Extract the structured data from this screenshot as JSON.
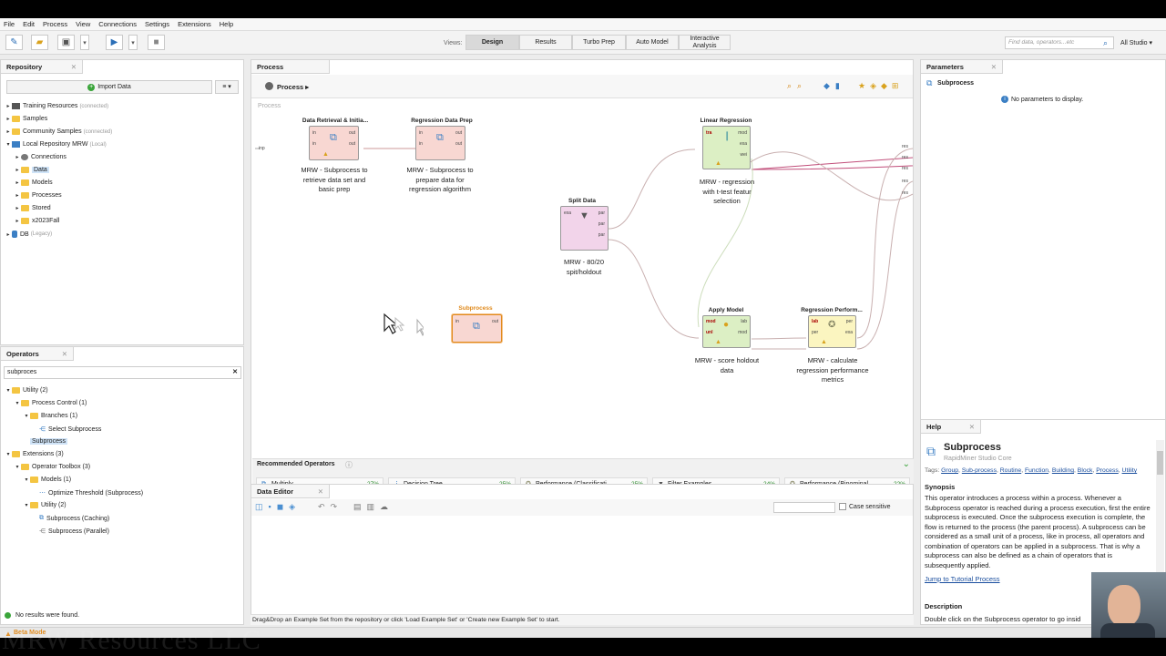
{
  "menu": [
    "File",
    "Edit",
    "Process",
    "View",
    "Connections",
    "Settings",
    "Extensions",
    "Help"
  ],
  "views": {
    "label": "Views:",
    "tabs": [
      "Design",
      "Results",
      "Turbo Prep",
      "Auto Model",
      "Interactive Analysis"
    ],
    "active": "Design"
  },
  "search": {
    "placeholder": "Find data, operators...etc",
    "studio": "All Studio"
  },
  "repository": {
    "title": "Repository",
    "import_label": "Import Data",
    "items": [
      {
        "label": "Training Resources",
        "note": "(connected)"
      },
      {
        "label": "Samples",
        "note": ""
      },
      {
        "label": "Community Samples",
        "note": "(connected)"
      },
      {
        "label": "Local Repository MRW",
        "note": "(Local)"
      },
      {
        "label": "Connections",
        "note": ""
      },
      {
        "label": "Data",
        "note": ""
      },
      {
        "label": "Models",
        "note": ""
      },
      {
        "label": "Processes",
        "note": ""
      },
      {
        "label": "Stored",
        "note": ""
      },
      {
        "label": "x2023Fall",
        "note": ""
      },
      {
        "label": "DB",
        "note": "(Legacy)"
      }
    ]
  },
  "operators": {
    "title": "Operators",
    "search_value": "subproces",
    "items": [
      "Utility (2)",
      "Process Control (1)",
      "Branches (1)",
      "Select Subprocess",
      "Subprocess",
      "Extensions (3)",
      "Operator Toolbox (3)",
      "Models (1)",
      "Optimize Threshold (Subprocess)",
      "Utility (2)",
      "Subprocess (Caching)",
      "Subprocess (Parallel)"
    ],
    "status": "No results were found."
  },
  "process": {
    "tab": "Process",
    "breadcrumb": "Process",
    "canvas_label": "Process",
    "operators": [
      {
        "title": "Data Retrieval & Initia...",
        "desc": "MRW - Subprocess to retrieve data set and basic prep"
      },
      {
        "title": "Regression Data Prep",
        "desc": "MRW - Subprocess to prepare data for regression algorithm"
      },
      {
        "title": "Split Data",
        "desc": "MRW - 80/20 spit/holdout"
      },
      {
        "title": "Linear Regression",
        "desc": "MRW - regression with t-test featur selection"
      },
      {
        "title": "Apply Model",
        "desc": "MRW - score holdout data"
      },
      {
        "title": "Regression Perform...",
        "desc": "MRW - calculate regression performance metrics"
      },
      {
        "title": "Subprocess",
        "desc": ""
      }
    ]
  },
  "recommended": {
    "title": "Recommended Operators",
    "items": [
      {
        "label": "Multiply",
        "pct": "27%"
      },
      {
        "label": "Decision Tree",
        "pct": "25%"
      },
      {
        "label": "Performance (Classificati...",
        "pct": "25%"
      },
      {
        "label": "Filter Examples",
        "pct": "24%"
      },
      {
        "label": "Performance (Binominal ...",
        "pct": "22%"
      }
    ]
  },
  "data_editor": {
    "title": "Data Editor",
    "case_sensitive": "Case sensitive",
    "hint": "Drag&Drop an Example Set from the repository or click 'Load Example Set' or 'Create new Example Set' to start."
  },
  "parameters": {
    "title": "Parameters",
    "operator": "Subprocess",
    "message": "No parameters to display."
  },
  "help": {
    "title": "Help",
    "op_name": "Subprocess",
    "op_source": "RapidMiner Studio Core",
    "tags_label": "Tags:",
    "tags": [
      "Group",
      "Sub-process",
      "Routine",
      "Function",
      "Building",
      "Block",
      "Process",
      "Utility"
    ],
    "synopsis_title": "Synopsis",
    "synopsis": "This operator introduces a process within a process. Whenever a Subprocess operator is reached during a process execution, first the entire subprocess is executed. Once the subprocess execution is complete, the flow is returned to the process (the parent process). A subprocess can be considered as a small unit of a process, like in process, all operators and combination of operators can be applied in a subprocess. That is why a subprocess can also be defined as a chain of operators that is subsequently applied.",
    "tutorial": "Jump to Tutorial Process",
    "desc_title": "Description",
    "desc": "Double click on the Subprocess operator to go insid"
  },
  "status_bar": {
    "mode": "Beta Mode"
  },
  "watermark": "MRW Resources LLC",
  "colors": {
    "accent": "#2c6fb7",
    "retrieval_op": "#f8d7d2",
    "split_op": "#f2d4ea",
    "model_op": "#dcefc4",
    "perf_op": "#fbf5c0"
  }
}
